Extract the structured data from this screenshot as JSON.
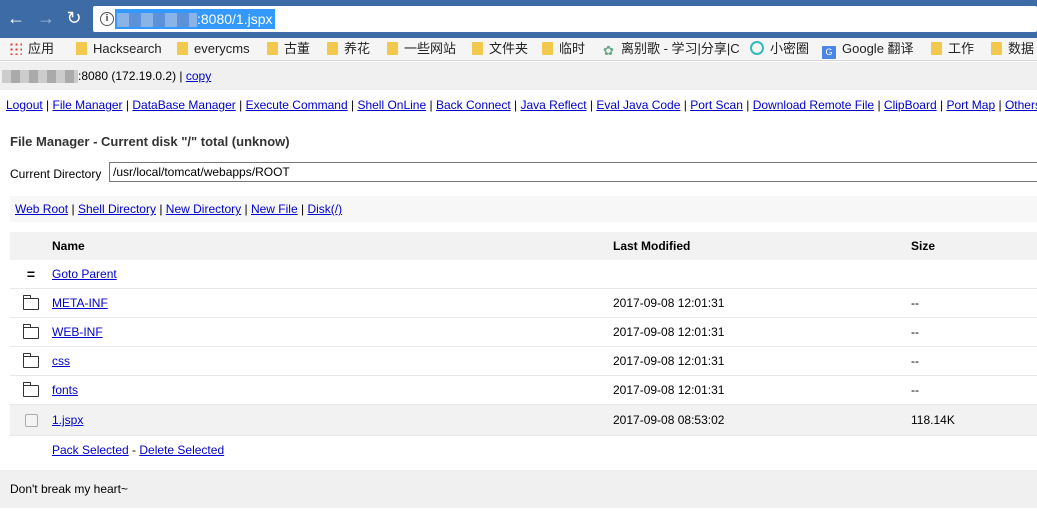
{
  "browser": {
    "url_tail": ":8080/1.jspx",
    "bookmarks": [
      "应用",
      "Hacksearch",
      "everycms",
      "古董",
      "养花",
      "一些网站",
      "文件夹",
      "临时",
      "离别歌 - 学习|分享|C",
      "小密圈",
      "Google 翻译",
      "工作",
      "数据"
    ]
  },
  "host": {
    "port_text": ":8080 (172.19.0.2) |",
    "copy_label": "copy"
  },
  "menu": [
    "Logout",
    "File Manager",
    "DataBase Manager",
    "Execute Command",
    "Shell OnLine",
    "Back Connect",
    "Java Reflect",
    "Eval Java Code",
    "Port Scan",
    "Download Remote File",
    "ClipBoard",
    "Port Map",
    "Others"
  ],
  "file_manager": {
    "title": "File Manager - Current disk \"/\" total (unknow)",
    "current_dir_label": "Current Directory",
    "current_dir_value": "/usr/local/tomcat/webapps/ROOT",
    "links": [
      "Web Root",
      "Shell Directory",
      "New Directory",
      "New File",
      "Disk(/)"
    ],
    "columns": [
      "Name",
      "Last Modified",
      "Size"
    ],
    "parent_icon": "=",
    "parent_label": "Goto Parent",
    "rows": [
      {
        "type": "folder-icon",
        "name": "META-INF",
        "modified": "2017-09-08 12:01:31",
        "size": "--"
      },
      {
        "type": "folder-icon",
        "name": "WEB-INF",
        "modified": "2017-09-08 12:01:31",
        "size": "--"
      },
      {
        "type": "folder-icon",
        "name": "css",
        "modified": "2017-09-08 12:01:31",
        "size": "--"
      },
      {
        "type": "folder-icon",
        "name": "fonts",
        "modified": "2017-09-08 12:01:31",
        "size": "--"
      },
      {
        "type": "file-checkbox",
        "name": "1.jspx",
        "modified": "2017-09-08 08:53:02",
        "size": "118.14K"
      }
    ],
    "pack_label": "Pack Selected",
    "actions_sep": " - ",
    "delete_label": "Delete Selected"
  },
  "footer": "Don't break my heart~"
}
